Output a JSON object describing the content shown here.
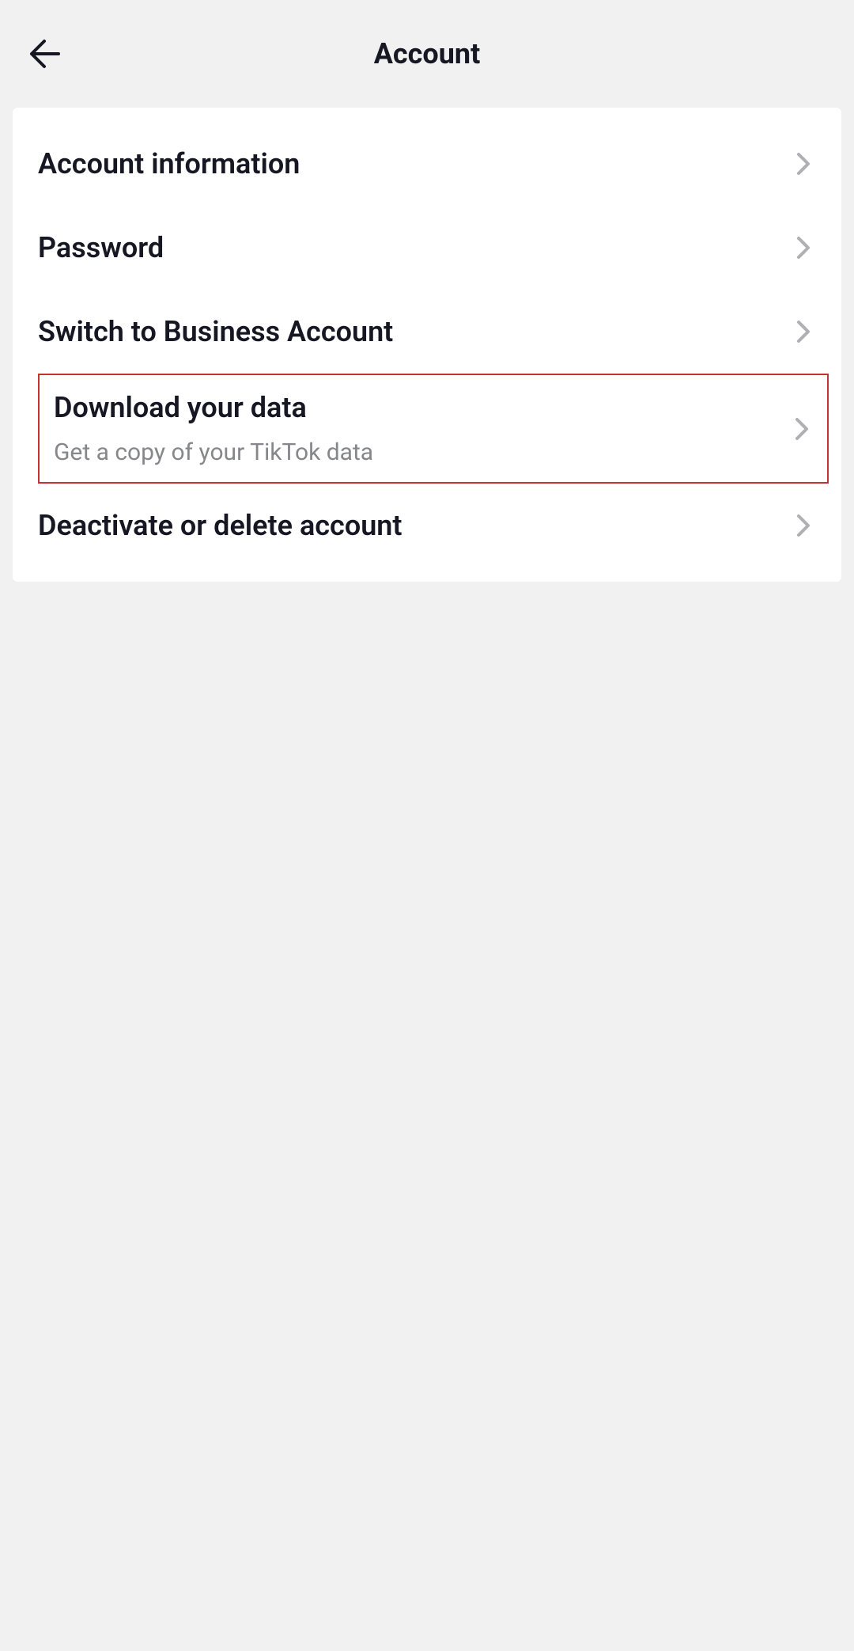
{
  "header": {
    "title": "Account"
  },
  "items": [
    {
      "label": "Account information",
      "sublabel": null,
      "highlight": false
    },
    {
      "label": "Password",
      "sublabel": null,
      "highlight": false
    },
    {
      "label": "Switch to Business Account",
      "sublabel": null,
      "highlight": false
    },
    {
      "label": "Download your data",
      "sublabel": "Get a copy of your TikTok data",
      "highlight": true
    },
    {
      "label": "Deactivate or delete account",
      "sublabel": null,
      "highlight": false
    }
  ]
}
